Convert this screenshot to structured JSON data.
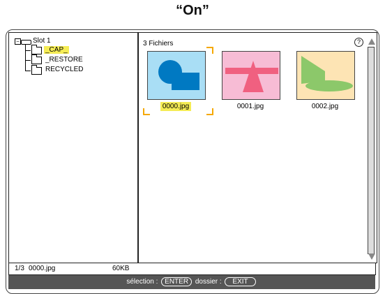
{
  "heading": "“On”",
  "tree": {
    "root": "Slot 1",
    "items": [
      {
        "label": "_CAP_",
        "selected": true
      },
      {
        "label": "_RESTORE",
        "selected": false
      },
      {
        "label": "RECYCLED",
        "selected": false
      }
    ]
  },
  "files": {
    "count_label": "3 Fichiers",
    "help_icon": "?",
    "thumbnails": [
      {
        "name": "0000.jpg",
        "selected": true
      },
      {
        "name": "0001.jpg",
        "selected": false
      },
      {
        "name": "0002.jpg",
        "selected": false
      }
    ]
  },
  "status": {
    "position": "1/3",
    "filename": "0000.jpg",
    "size": "60KB"
  },
  "footer": {
    "select_label": "sélection :",
    "select_key": "ENTER",
    "folder_label": "dossier :",
    "folder_key": "EXIT"
  },
  "colors": {
    "selection": "#f5ec55",
    "focus_corners": "#f5a800",
    "thumb0_bg": "#a9def5",
    "thumb1_bg": "#f7bcd5",
    "thumb2_bg": "#fde4b4"
  }
}
